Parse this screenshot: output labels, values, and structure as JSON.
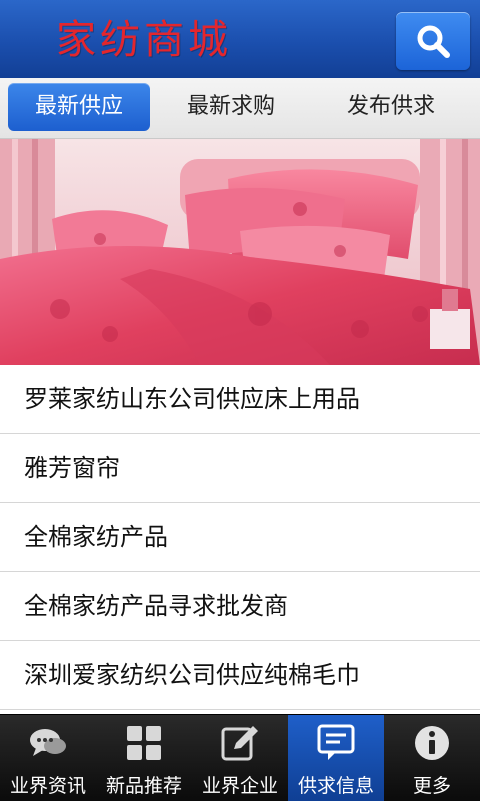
{
  "header": {
    "title": "家纺商城",
    "title_color": "#e4262d",
    "search_icon": "search-icon"
  },
  "tabs": [
    {
      "label": "最新供应",
      "active": true
    },
    {
      "label": "最新求购",
      "active": false
    },
    {
      "label": "发布供求",
      "active": false
    }
  ],
  "list": {
    "items": [
      "罗莱家纺山东公司供应床上用品",
      "雅芳窗帘",
      "全棉家纺产品",
      "全棉家纺产品寻求批发商",
      "深圳爱家纺织公司供应纯棉毛巾"
    ]
  },
  "bottom_nav": [
    {
      "label": "业界资讯",
      "icon": "chat-bubbles-icon",
      "active": false
    },
    {
      "label": "新品推荐",
      "icon": "grid-icon",
      "active": false
    },
    {
      "label": "业界企业",
      "icon": "edit-icon",
      "active": false
    },
    {
      "label": "供求信息",
      "icon": "message-icon",
      "active": true
    },
    {
      "label": "更多",
      "icon": "info-icon",
      "active": false
    }
  ],
  "colors": {
    "header_blue": "#1b4fae",
    "active_tab": "#1d5fcf",
    "nav_bg": "#111111",
    "nav_active": "#1f5fc9",
    "banner_pink": "#e8476d"
  }
}
